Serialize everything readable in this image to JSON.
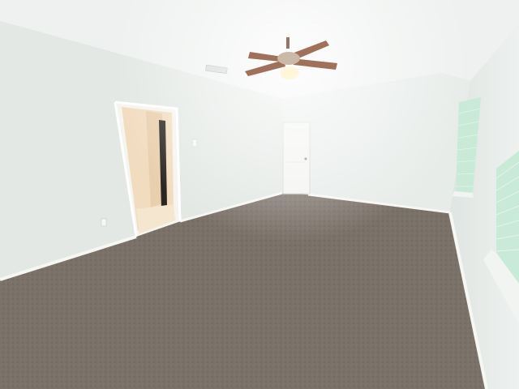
{
  "scene": {
    "description_type": "photo",
    "colors": {
      "ceiling": "#eef1ef",
      "left_wall": "#e3e8e4",
      "back_wall": "#e7ece9",
      "right_wall": "#dfe5e2",
      "carpet": "#6f655c",
      "baseboard": "#f6f6f3",
      "door": "#f3f4f1",
      "hallway_wall": "#f2dcc0",
      "hallway_floor": "#f5e6cf",
      "window_light": "#c8ead6",
      "fan_blade": "#a0705a"
    }
  }
}
